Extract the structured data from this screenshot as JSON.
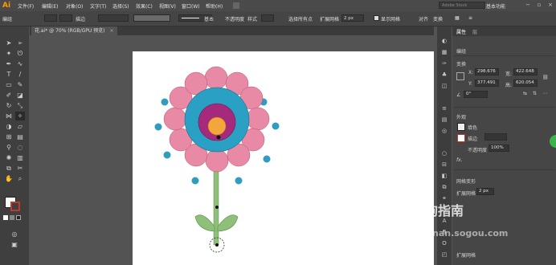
{
  "app": {
    "logo": "Ai",
    "brand": "传统基本功能",
    "search_placeholder": "Adobe Stock"
  },
  "menu": [
    "文件(F)",
    "编辑(E)",
    "对象(O)",
    "文字(T)",
    "选择(S)",
    "效果(C)",
    "视图(V)",
    "窗口(W)",
    "帮助(H)"
  ],
  "control": {
    "stroke_label": "描边",
    "stroke_profile": "基本",
    "opacity_label": "不透明度",
    "style_label": "样式",
    "select_same": "选择所有点",
    "expand_label": "扩展网格",
    "expand_value": "2 px",
    "show_grid": "显示网格",
    "align": "对齐",
    "transform": "变换"
  },
  "document": {
    "tab_title": "花.ai* @ 70% (RGB/GPU 预览)",
    "close": "×"
  },
  "panel": {
    "tabs": [
      "属性",
      "层"
    ],
    "section_edit": "编组",
    "section_transform": "变换",
    "x_label": "X:",
    "x_value": "298.676",
    "y_label": "Y:",
    "y_value": "377.491",
    "w_label": "宽:",
    "w_value": "422.648",
    "h_label": "高:",
    "h_value": "620.054",
    "angle_value": "0°",
    "section_appearance": "外观",
    "fill_label": "填色",
    "stroke_label": "描边",
    "opacity_label": "不透明度",
    "opacity_value": "100%",
    "fx": "fx.",
    "section_grid": "网格变形",
    "expand_label": "扩展网格",
    "expand_value": "2 px",
    "expand_label2": "扩展网格"
  },
  "watermark": {
    "text": "搜狗指南",
    "url": "zhinan.sogou.com"
  }
}
